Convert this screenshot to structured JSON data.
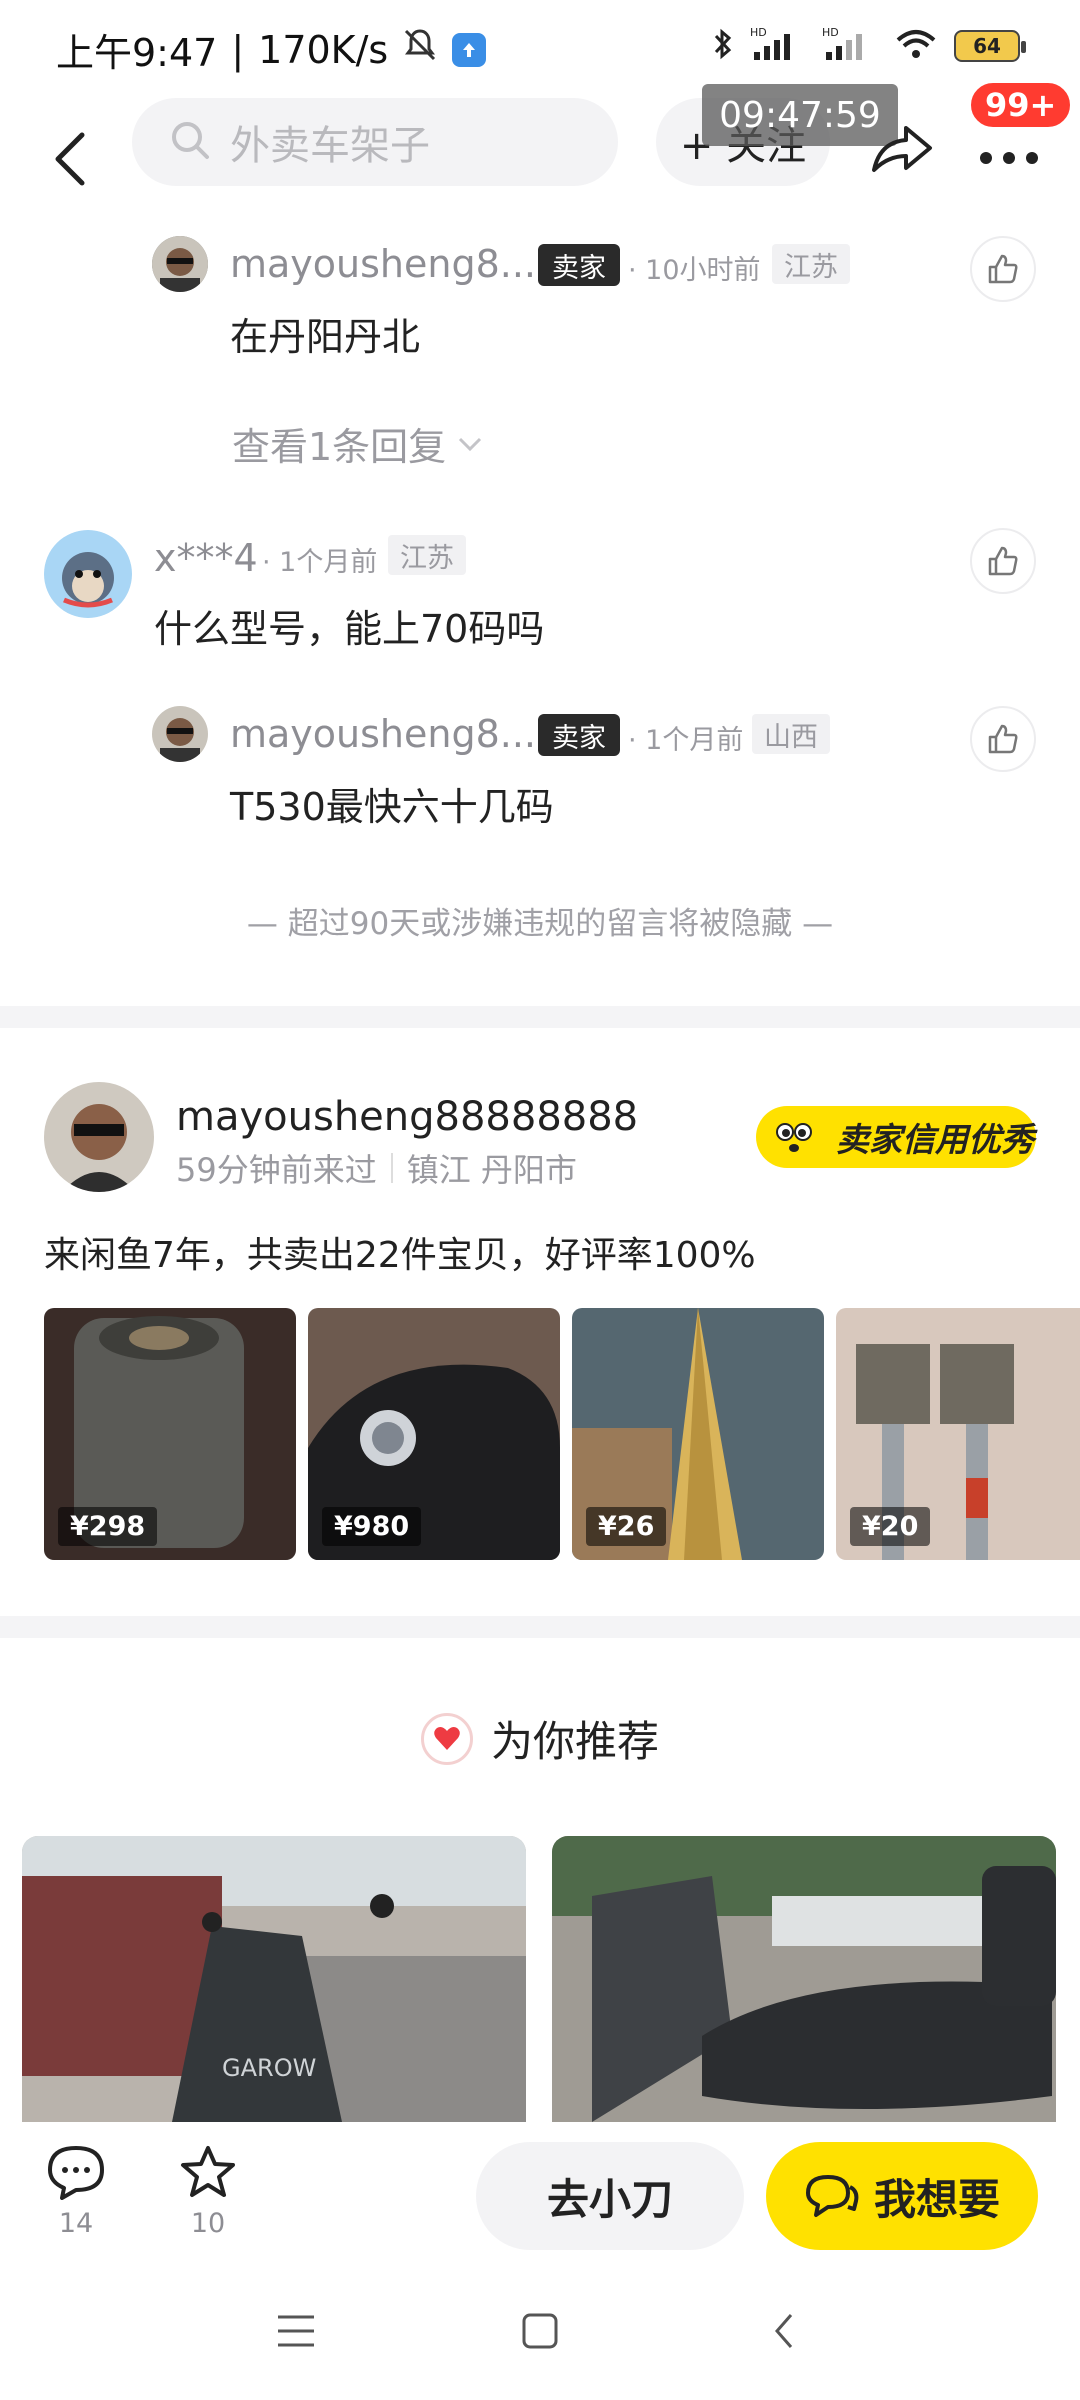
{
  "status_bar": {
    "time": "上午9:47",
    "net_speed": "170K/s",
    "battery": "64",
    "network_label": "HD"
  },
  "nav": {
    "search_placeholder": "外卖车架子",
    "follow_label": "+ 关注",
    "time_overlay": "09:47:59",
    "notification_count": "99+"
  },
  "comments": [
    {
      "name": "mayousheng8...",
      "tag": "卖家",
      "time": "· 10小时前",
      "location": "江苏",
      "text": "在丹阳丹北"
    },
    {
      "view_replies": "查看1条回复"
    },
    {
      "name": "x***4",
      "time": "· 1个月前",
      "location": "江苏",
      "text": "什么型号，能上70码吗"
    },
    {
      "name": "mayousheng8...",
      "tag": "卖家",
      "time": "· 1个月前",
      "location": "山西",
      "text": "T530最快六十几码"
    }
  ],
  "notice": "— 超过90天或涉嫌违规的留言将被隐藏 —",
  "seller": {
    "name": "mayousheng88888888",
    "last_seen": "59分钟前来过",
    "location": "镇江 丹阳市",
    "credit_badge": "卖家信用优秀",
    "description": "来闲鱼7年，共卖出22件宝贝，好评率100%",
    "items": [
      {
        "price": "¥298",
        "color": "#4a4a48"
      },
      {
        "price": "¥980",
        "color": "#2c2c2e"
      },
      {
        "price": "¥26",
        "color": "#b8955a"
      },
      {
        "price": "¥20",
        "color": "#8a7d70"
      }
    ]
  },
  "recommend": {
    "title": "为你推荐"
  },
  "bottom_bar": {
    "comment_count": "14",
    "fav_count": "10",
    "go_label": "去小刀",
    "want_label": "我想要"
  },
  "colors": {
    "accent": "#ffe100",
    "badge_red": "#ff3b30"
  }
}
